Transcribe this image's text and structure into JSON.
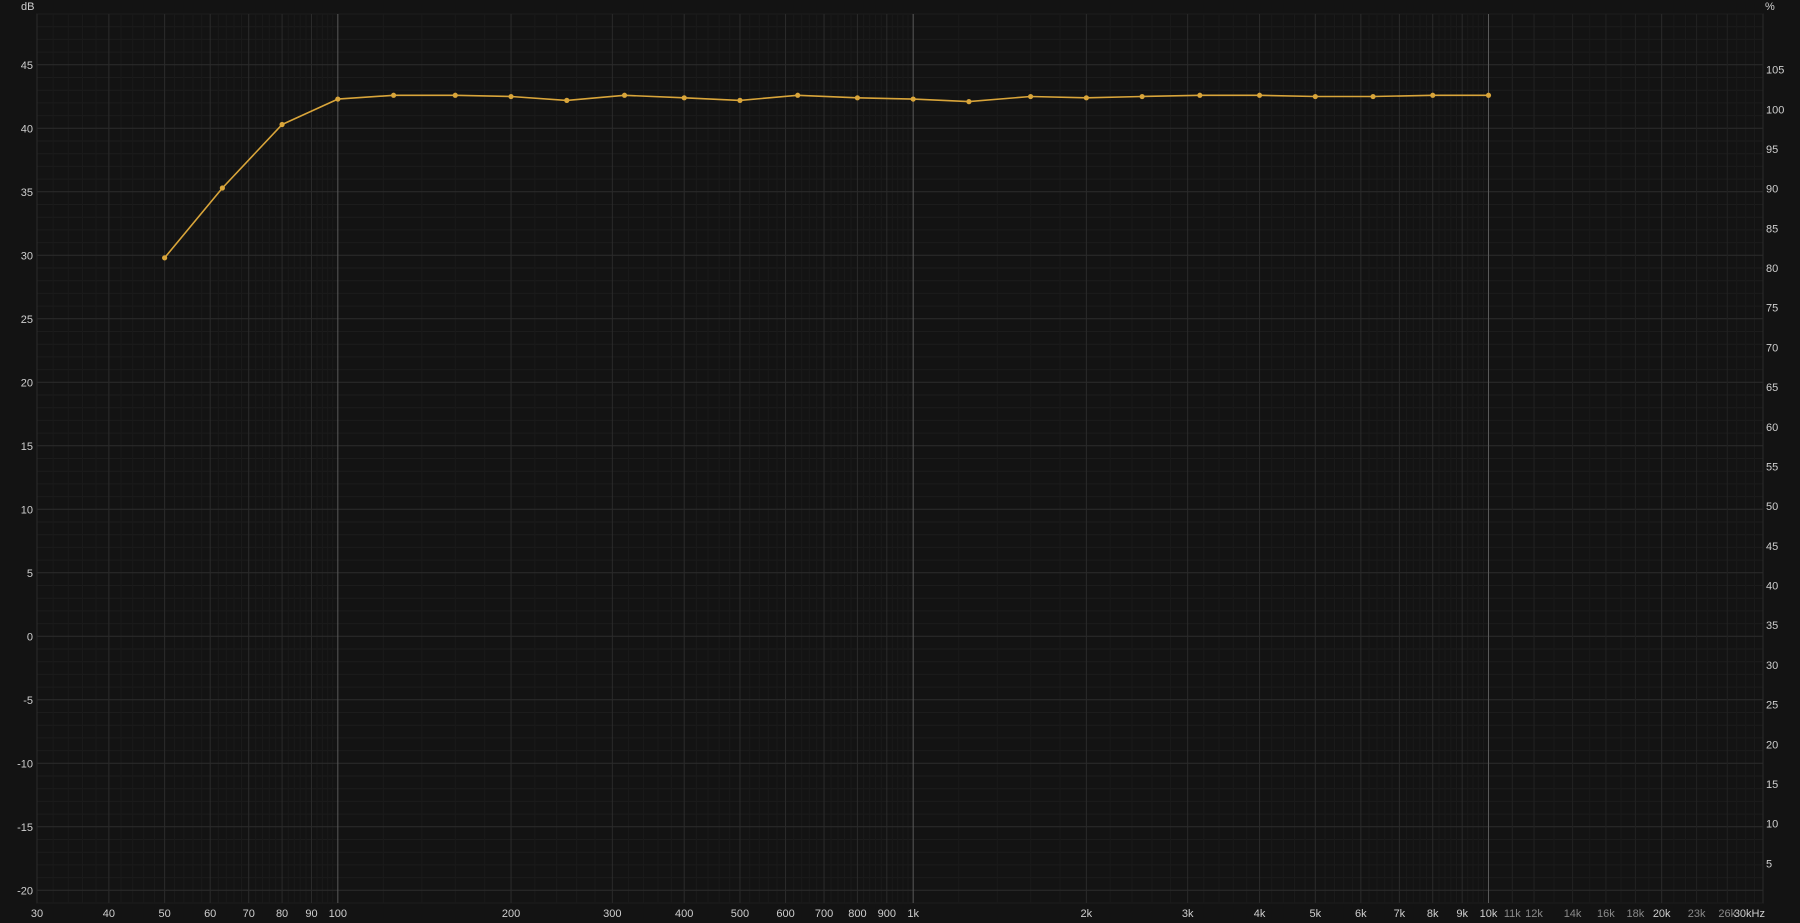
{
  "chart_data": {
    "type": "line",
    "xscale": "log",
    "xlim": [
      30,
      30000
    ],
    "ylim": [
      -21,
      49
    ],
    "y2lim": [
      0,
      112
    ],
    "ylabel": "dB",
    "y2label": "%",
    "grid": true,
    "series_color": "#d9a53a",
    "background": "#131313",
    "x_ticks": [
      {
        "value": 30,
        "label": "30",
        "dim": false
      },
      {
        "value": 40,
        "label": "40",
        "dim": false
      },
      {
        "value": 50,
        "label": "50",
        "dim": false
      },
      {
        "value": 60,
        "label": "60",
        "dim": false
      },
      {
        "value": 70,
        "label": "70",
        "dim": false
      },
      {
        "value": 80,
        "label": "80",
        "dim": false
      },
      {
        "value": 90,
        "label": "90",
        "dim": false
      },
      {
        "value": 100,
        "label": "100",
        "dim": false
      },
      {
        "value": 200,
        "label": "200",
        "dim": false
      },
      {
        "value": 300,
        "label": "300",
        "dim": false
      },
      {
        "value": 400,
        "label": "400",
        "dim": false
      },
      {
        "value": 500,
        "label": "500",
        "dim": false
      },
      {
        "value": 600,
        "label": "600",
        "dim": false
      },
      {
        "value": 700,
        "label": "700",
        "dim": false
      },
      {
        "value": 800,
        "label": "800",
        "dim": false
      },
      {
        "value": 900,
        "label": "900",
        "dim": false
      },
      {
        "value": 1000,
        "label": "1k",
        "dim": false
      },
      {
        "value": 2000,
        "label": "2k",
        "dim": false
      },
      {
        "value": 3000,
        "label": "3k",
        "dim": false
      },
      {
        "value": 4000,
        "label": "4k",
        "dim": false
      },
      {
        "value": 5000,
        "label": "5k",
        "dim": false
      },
      {
        "value": 6000,
        "label": "6k",
        "dim": false
      },
      {
        "value": 7000,
        "label": "7k",
        "dim": false
      },
      {
        "value": 8000,
        "label": "8k",
        "dim": false
      },
      {
        "value": 9000,
        "label": "9k",
        "dim": false
      },
      {
        "value": 10000,
        "label": "10k",
        "dim": false
      },
      {
        "value": 11000,
        "label": "11k",
        "dim": true
      },
      {
        "value": 12000,
        "label": "12k",
        "dim": true
      },
      {
        "value": 14000,
        "label": "14k",
        "dim": true
      },
      {
        "value": 16000,
        "label": "16k",
        "dim": true
      },
      {
        "value": 18000,
        "label": "18k",
        "dim": true
      },
      {
        "value": 20000,
        "label": "20k",
        "dim": false
      },
      {
        "value": 23000,
        "label": "23k",
        "dim": true
      },
      {
        "value": 26000,
        "label": "26k",
        "dim": true
      },
      {
        "value": 30000,
        "label": "30kHz",
        "dim": false
      }
    ],
    "y_ticks": [
      {
        "value": 45,
        "label": "45"
      },
      {
        "value": 40,
        "label": "40"
      },
      {
        "value": 35,
        "label": "35"
      },
      {
        "value": 30,
        "label": "30"
      },
      {
        "value": 25,
        "label": "25"
      },
      {
        "value": 20,
        "label": "20"
      },
      {
        "value": 15,
        "label": "15"
      },
      {
        "value": 10,
        "label": "10"
      },
      {
        "value": 5,
        "label": "5"
      },
      {
        "value": 0,
        "label": "0"
      },
      {
        "value": -5,
        "label": "-5"
      },
      {
        "value": -10,
        "label": "-10"
      },
      {
        "value": -15,
        "label": "-15"
      },
      {
        "value": -20,
        "label": "-20"
      }
    ],
    "y2_ticks": [
      {
        "value": 105,
        "label": "105"
      },
      {
        "value": 100,
        "label": "100"
      },
      {
        "value": 95,
        "label": "95"
      },
      {
        "value": 90,
        "label": "90"
      },
      {
        "value": 85,
        "label": "85"
      },
      {
        "value": 80,
        "label": "80"
      },
      {
        "value": 75,
        "label": "75"
      },
      {
        "value": 70,
        "label": "70"
      },
      {
        "value": 65,
        "label": "65"
      },
      {
        "value": 60,
        "label": "60"
      },
      {
        "value": 55,
        "label": "55"
      },
      {
        "value": 50,
        "label": "50"
      },
      {
        "value": 45,
        "label": "45"
      },
      {
        "value": 40,
        "label": "40"
      },
      {
        "value": 35,
        "label": "35"
      },
      {
        "value": 30,
        "label": "30"
      },
      {
        "value": 25,
        "label": "25"
      },
      {
        "value": 20,
        "label": "20"
      },
      {
        "value": 15,
        "label": "15"
      },
      {
        "value": 10,
        "label": "10"
      },
      {
        "value": 5,
        "label": "5"
      }
    ],
    "series": [
      {
        "x": [
          50,
          63,
          80,
          100,
          125,
          160,
          200,
          250,
          315,
          400,
          500,
          630,
          800,
          1000,
          1250,
          1600,
          2000,
          2500,
          3150,
          4000,
          5000,
          6300,
          8000,
          10000
        ],
        "y": [
          29.8,
          35.3,
          40.3,
          42.3,
          42.6,
          42.6,
          42.5,
          42.2,
          42.6,
          42.4,
          42.2,
          42.6,
          42.4,
          42.3,
          42.1,
          42.5,
          42.4,
          42.5,
          42.6,
          42.6,
          42.5,
          42.5,
          42.6,
          42.6
        ]
      }
    ]
  }
}
